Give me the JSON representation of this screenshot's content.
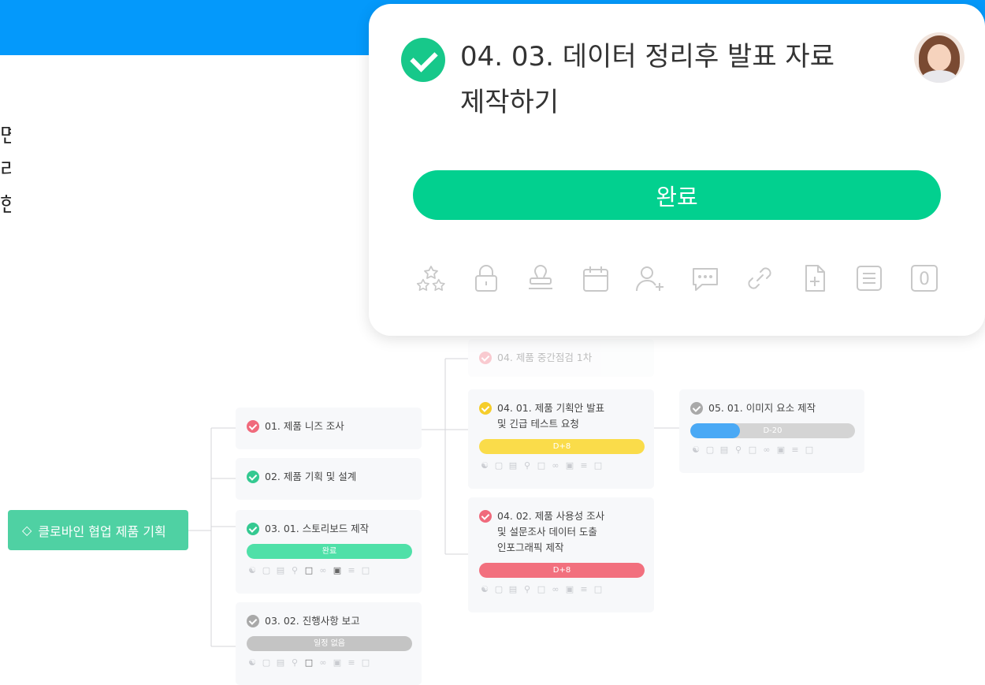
{
  "colors": {
    "brand_blue": "#0499fb",
    "done_green": "#02d08f",
    "root_green": "#4fd1a3",
    "red": "#f2707e",
    "yellow": "#fadc4a",
    "gray": "#c4c4c4",
    "progress_blue": "#4aa9f5"
  },
  "side_text": [
    "면",
    "리",
    "한"
  ],
  "root": {
    "icon": "layers-icon",
    "label": "클로바인 협업 제품 기획"
  },
  "cards": {
    "c0101": {
      "status": "red",
      "title": "01. 제품 니즈 조사"
    },
    "c0102": {
      "status": "green",
      "title": "02. 제품 기획 및 설계"
    },
    "c0301": {
      "status": "green",
      "title": "03. 01. 스토리보드 제작",
      "pill": "완료"
    },
    "c0302": {
      "status": "gray",
      "title": "03. 02. 진행사항 보고",
      "pill": "일정 없음"
    },
    "c04": {
      "status": "red",
      "title": "04. 제품 중간점검 1차"
    },
    "c0401": {
      "status": "yellow",
      "title_lines": [
        "04. 01. 제품 기획안 발표",
        "및 긴급 테스트 요청"
      ],
      "pill": "D+8"
    },
    "c0402": {
      "status": "red",
      "title_lines": [
        "04. 02. 제품 사용성 조사",
        "및 설문조사 데이터 도출",
        "인포그래픽 제작"
      ],
      "pill": "D+8"
    },
    "c0501": {
      "status": "gray",
      "title": "05. 01. 이미지 요소 제작",
      "pill": "D-20",
      "progress": 0.3
    }
  },
  "mini_icons": [
    "org-icon",
    "lock-icon",
    "calendar-icon",
    "add-user-icon",
    "comment-icon",
    "link-icon",
    "file-add-icon",
    "list-icon",
    "square-icon"
  ],
  "popup": {
    "title_lines": [
      "04. 03. 데이터 정리후 발표 자료",
      "제작하기"
    ],
    "done_label": "완료",
    "toolbar": [
      "stars-icon",
      "lock-icon",
      "stamp-icon",
      "calendar-icon",
      "add-user-icon",
      "comment-icon",
      "link-icon",
      "file-add-icon",
      "list-icon",
      "zero-box-icon"
    ],
    "zero_box": "0"
  }
}
